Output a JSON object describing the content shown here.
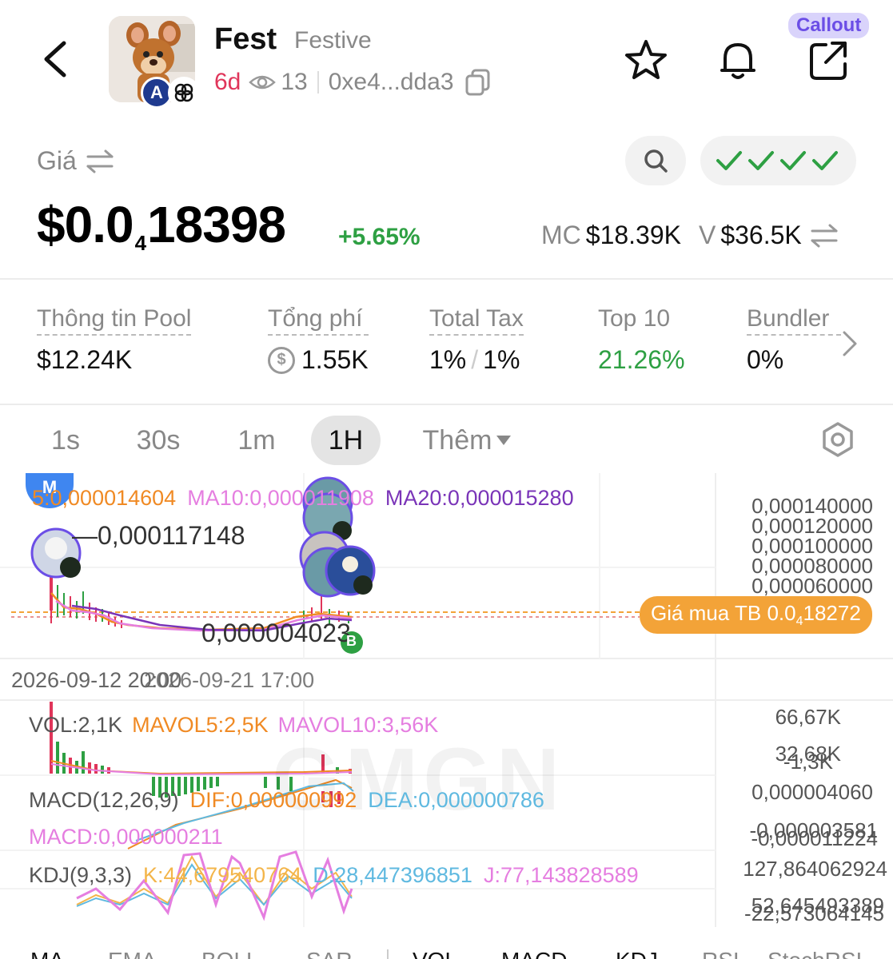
{
  "header": {
    "name": "Fest",
    "subtitle": "Festive",
    "age": "6d",
    "views": "13",
    "address": "0xe4...dda3",
    "callout": "Callout"
  },
  "price": {
    "label": "Giá",
    "main_prefix": "$0.0",
    "zero_count": "4",
    "main_digits": "18398",
    "change": "+5.65%",
    "mc_label": "MC",
    "mc_value": "$18.39K",
    "v_label": "V",
    "v_value": "$36.5K"
  },
  "stats": [
    {
      "label": "Thông tin Pool",
      "value": "$12.24K"
    },
    {
      "label": "Tổng phí",
      "value": "1.55K"
    },
    {
      "label": "Total Tax",
      "value_a": "1%",
      "value_b": "1%"
    },
    {
      "label": "Top 10",
      "value": "21.26%"
    },
    {
      "label": "Bundler",
      "value": "0%"
    }
  ],
  "timeframes": [
    "1s",
    "30s",
    "1m",
    "1H"
  ],
  "timeframe_active": "1H",
  "timeframe_more": "Thêm",
  "chart": {
    "marker_m": "M",
    "marker_b": "B",
    "ma5": "5:0,000014604",
    "ma10": "MA10:0,000011908",
    "ma20": "MA20:0,000015280",
    "y_ticks": [
      "0,000140000",
      "0,000120000",
      "0,000100000",
      "0,000080000",
      "0,000060000"
    ],
    "high_label": "0,000117148",
    "low_label": "0,000004023",
    "buy_avg_prefix": "Giá mua TB 0.0",
    "buy_avg_zeros": "4",
    "buy_avg_digits": "18272",
    "date_a": "2026-09-12 20:00",
    "date_b": "2026-09-21 17:00",
    "vol": "VOL:2,1K",
    "mavol5": "MAVOL5:2,5K",
    "mavol10": "MAVOL10:3,56K",
    "vol_ticks": [
      "66,67K",
      "32,68K",
      "-1,3K"
    ],
    "macd_title": "MACD(12,26,9)",
    "dif": "DIF:0,000000992",
    "dea": "DEA:0,000000786",
    "macd_val": "MACD:0,000000211",
    "macd_ticks": [
      "0,000004060",
      "-0,000003581",
      "-0,000011224"
    ],
    "kdj_title": "KDJ(9,3,3)",
    "kdj_k": "K:44,679540764",
    "kdj_d": "D:28,447396851",
    "kdj_j": "J:77,143828589",
    "kdj_ticks": [
      "127,864062924",
      "52,645493389",
      "-22,573064145"
    ],
    "watermark": "GMGN"
  },
  "indicator_tabs": [
    "MA",
    "EMA",
    "BOLL",
    "SAR",
    "VOL",
    "MACD",
    "KDJ",
    "RSI",
    "StochRSI"
  ],
  "colors": {
    "up": "#2ea043",
    "down": "#e0355a",
    "ma5": "#f08a24",
    "ma10": "#e57ee0",
    "ma20": "#7a34b8",
    "buy_avg": "#f3a338"
  }
}
